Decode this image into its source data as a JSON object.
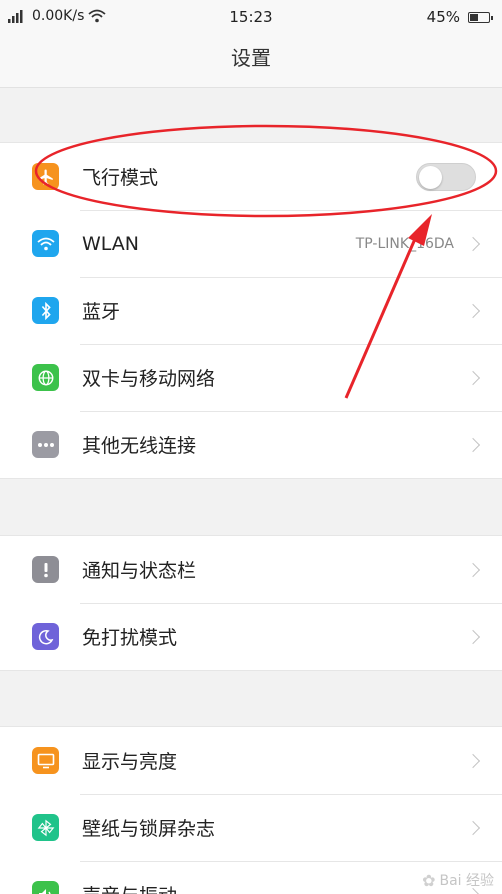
{
  "status_bar": {
    "network_speed": "0.00K/s",
    "time": "15:23",
    "battery": "45%",
    "battery_level": 0.45
  },
  "header": {
    "title": "设置"
  },
  "groups": [
    {
      "items": [
        {
          "label": "飞行模式",
          "icon": "airplane-icon",
          "icon_color": "#f6931e",
          "toggle": false
        },
        {
          "label": "WLAN",
          "value": "TP-LINK_16DA",
          "icon": "wifi-icon",
          "icon_color": "#1fa6ee"
        },
        {
          "label": "蓝牙",
          "icon": "bluetooth-icon",
          "icon_color": "#1fa6ee"
        },
        {
          "label": "双卡与移动网络",
          "icon": "globe-icon",
          "icon_color": "#3cc24b"
        },
        {
          "label": "其他无线连接",
          "icon": "more-icon",
          "icon_color": "#9b9ba3"
        }
      ]
    },
    {
      "items": [
        {
          "label": "通知与状态栏",
          "icon": "exclamation-icon",
          "icon_color": "#8e8e95"
        },
        {
          "label": "免打扰模式",
          "icon": "moon-icon",
          "icon_color": "#6f63d9"
        }
      ]
    },
    {
      "items": [
        {
          "label": "显示与亮度",
          "icon": "display-icon",
          "icon_color": "#f6931e"
        },
        {
          "label": "壁纸与锁屏杂志",
          "icon": "pinwheel-icon",
          "icon_color": "#20c38a"
        },
        {
          "label": "声音与振动",
          "icon": "speaker-icon",
          "icon_color": "#3cc24b"
        }
      ]
    }
  ],
  "watermark": {
    "text": "Bai 经验"
  },
  "annotation": {
    "stroke_color": "#e8242a"
  }
}
